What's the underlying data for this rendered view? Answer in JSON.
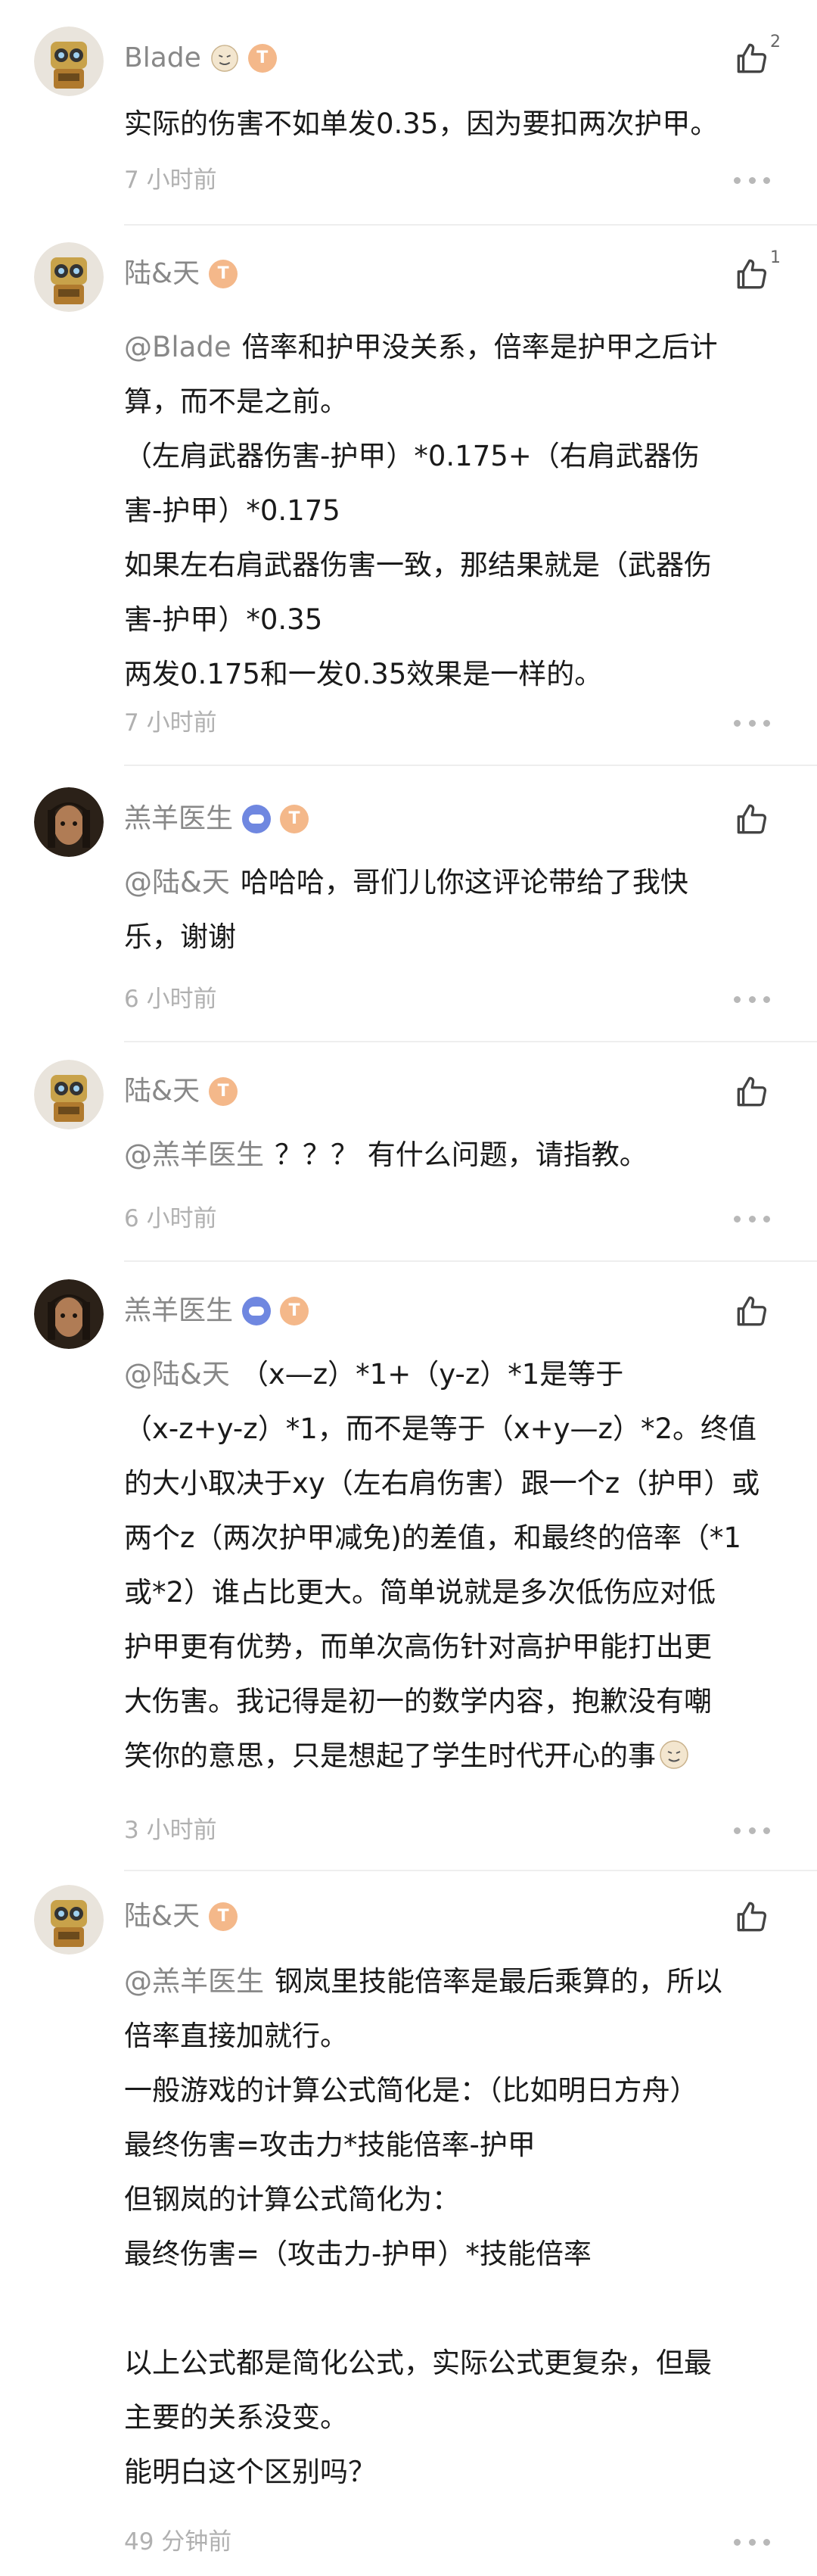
{
  "comments": [
    {
      "user": "Blade",
      "avatar": "robot-avatar",
      "badges": [
        "robot-emoji-badge",
        "level-badge"
      ],
      "level_badge": "T",
      "likes": "2",
      "lines": [
        {
          "mention": "",
          "text": "实际的伤害不如单发0.35，因为要扣两次护甲。"
        }
      ],
      "time": "7 小时前"
    },
    {
      "user": "陆&天",
      "avatar": "robot-avatar",
      "badges": [
        "level-badge"
      ],
      "level_badge": "T",
      "likes": "1",
      "lines": [
        {
          "mention": "@Blade",
          "text": "倍率和护甲没关系，倍率是护甲之后计"
        },
        {
          "mention": "",
          "text": "算，而不是之前。"
        },
        {
          "mention": "",
          "text": "（左肩武器伤害-护甲）*0.175+（右肩武器伤"
        },
        {
          "mention": "",
          "text": "害-护甲）*0.175"
        },
        {
          "mention": "",
          "text": "如果左右肩武器伤害一致，那结果就是（武器伤"
        },
        {
          "mention": "",
          "text": "害-护甲）*0.35"
        },
        {
          "mention": "",
          "text": "两发0.175和一发0.35效果是一样的。"
        }
      ],
      "time": "7 小时前"
    },
    {
      "user": "羔羊医生",
      "avatar": "man-avatar",
      "badges": [
        "game-badge",
        "level-badge"
      ],
      "level_badge": "T",
      "likes": "",
      "lines": [
        {
          "mention": "@陆&天",
          "text": "哈哈哈，哥们儿你这评论带给了我快"
        },
        {
          "mention": "",
          "text": "乐，谢谢"
        }
      ],
      "time": "6 小时前"
    },
    {
      "user": "陆&天",
      "avatar": "robot-avatar",
      "badges": [
        "level-badge"
      ],
      "level_badge": "T",
      "likes": "",
      "lines": [
        {
          "mention": "@羔羊医生",
          "text": "？？？ 有什么问题，请指教。"
        }
      ],
      "time": "6 小时前"
    },
    {
      "user": "羔羊医生",
      "avatar": "man-avatar",
      "badges": [
        "game-badge",
        "level-badge"
      ],
      "level_badge": "T",
      "likes": "",
      "lines": [
        {
          "mention": "@陆&天",
          "text": "（x—z）*1+（y-z）*1是等于"
        },
        {
          "mention": "",
          "text": "（x-z+y-z）*1，而不是等于（x+y—z）*2。终值"
        },
        {
          "mention": "",
          "text": "的大小取决于xy（左右肩伤害）跟一个z（护甲）或"
        },
        {
          "mention": "",
          "text": "两个z（两次护甲减免)的差值，和最终的倍率（*1"
        },
        {
          "mention": "",
          "text": "或*2）谁占比更大。简单说就是多次低伤应对低"
        },
        {
          "mention": "",
          "text": "护甲更有优势，而单次高伤针对高护甲能打出更"
        },
        {
          "mention": "",
          "text": "大伤害。我记得是初一的数学内容，抱歉没有嘲"
        },
        {
          "mention": "",
          "text": "笑你的意思，只是想起了学生时代开心的事"
        }
      ],
      "time": "3 小时前"
    },
    {
      "user": "陆&天",
      "avatar": "robot-avatar",
      "badges": [
        "level-badge"
      ],
      "level_badge": "T",
      "likes": "",
      "lines": [
        {
          "mention": "@羔羊医生",
          "text": "钢岚里技能倍率是最后乘算的，所以"
        },
        {
          "mention": "",
          "text": "倍率直接加就行。"
        },
        {
          "mention": "",
          "text": "一般游戏的计算公式简化是：（比如明日方舟）"
        },
        {
          "mention": "",
          "text": "最终伤害=攻击力*技能倍率-护甲"
        },
        {
          "mention": "",
          "text": "但钢岚的计算公式简化为："
        },
        {
          "mention": "",
          "text": "最终伤害=（攻击力-护甲）*技能倍率"
        },
        {
          "mention": "",
          "text": ""
        },
        {
          "mention": "",
          "text": "以上公式都是简化公式，实际公式更复杂，但最"
        },
        {
          "mention": "",
          "text": "主要的关系没变。"
        },
        {
          "mention": "",
          "text": "能明白这个区别吗？"
        }
      ],
      "time": "49 分钟前"
    }
  ]
}
